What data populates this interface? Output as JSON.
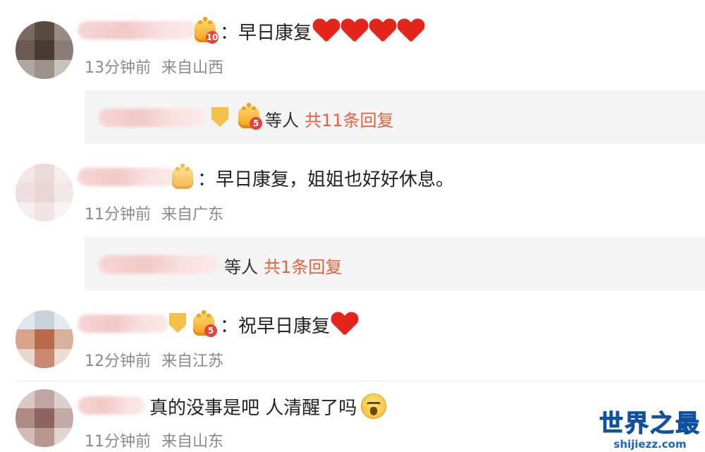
{
  "comments": [
    {
      "text": "：早日康复",
      "emoji": [
        "heart",
        "heart",
        "heart",
        "heart"
      ],
      "time": "13分钟前",
      "location": "来自山西",
      "badge_level": "10",
      "reply": {
        "who_suffix": "等人",
        "count": "共11条回复",
        "badge_level": "5"
      }
    },
    {
      "text": "：早日康复，姐姐也好好休息。",
      "time": "11分钟前",
      "location": "来自广东",
      "reply": {
        "who_suffix": "等人",
        "count": "共1条回复"
      }
    },
    {
      "text": "：祝早日康复",
      "emoji": [
        "heart"
      ],
      "time": "12分钟前",
      "location": "来自江苏",
      "badge_level": "5"
    },
    {
      "text": "真的没事是吧 人清醒了吗",
      "emoji": [
        "cry-face"
      ],
      "time": "11分钟前",
      "location": "来自山东"
    }
  ],
  "watermark": {
    "title": "世界之最",
    "url": "shijiezz.com"
  },
  "colors": {
    "reply_count": "#e8613c",
    "meta": "#8a8a8a",
    "heart": "#e4251c",
    "watermark": "#1565c8"
  }
}
